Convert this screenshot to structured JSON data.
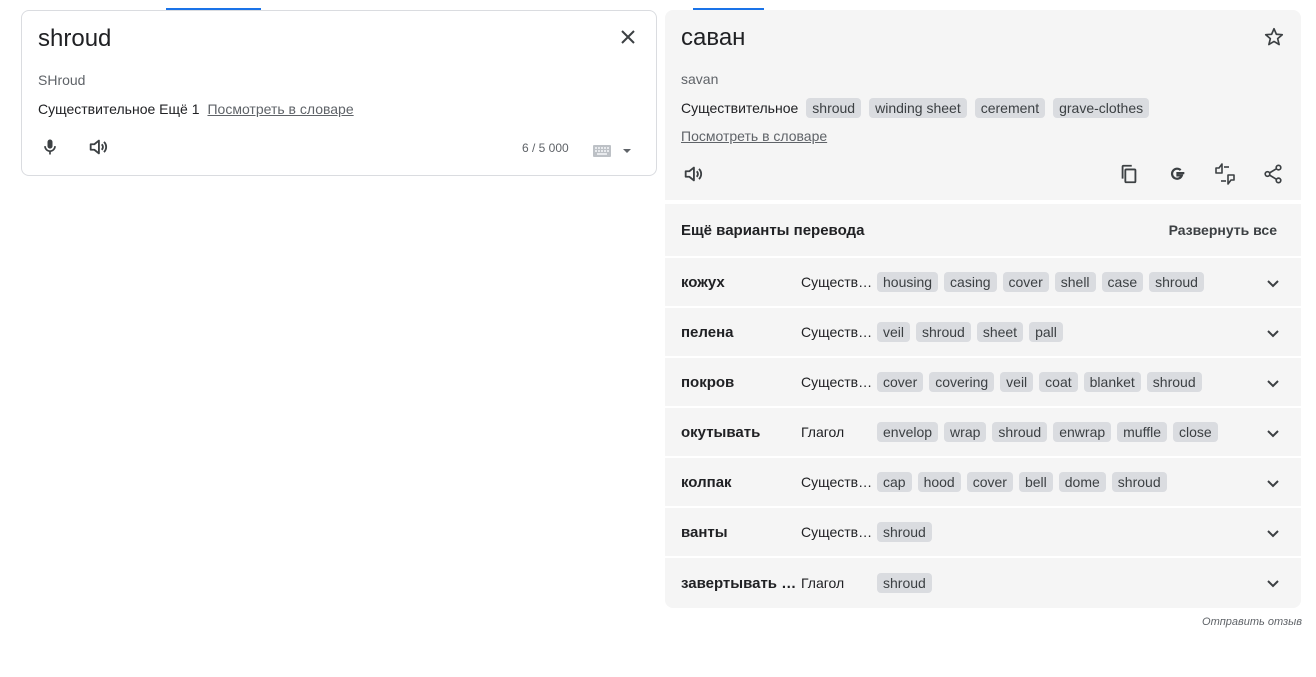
{
  "source": {
    "text": "shroud",
    "transliteration": "SHroud",
    "pos_label": "Существительное Ещё 1",
    "dictionary_link": "Посмотреть в словаре",
    "char_count": "6 / 5 000"
  },
  "target": {
    "text": "саван",
    "transliteration": "savan",
    "pos_label": "Существительное",
    "chips": [
      "shroud",
      "winding sheet",
      "cerement",
      "grave-clothes"
    ],
    "dictionary_link": "Посмотреть в словаре"
  },
  "alternatives": {
    "title": "Ещё варианты перевода",
    "expand_all": "Развернуть все",
    "rows": [
      {
        "word": "кожух",
        "pos": "Существительное",
        "chips": [
          "housing",
          "casing",
          "cover",
          "shell",
          "case",
          "shroud"
        ]
      },
      {
        "word": "пелена",
        "pos": "Существительное",
        "chips": [
          "veil",
          "shroud",
          "sheet",
          "pall"
        ]
      },
      {
        "word": "покров",
        "pos": "Существительное",
        "chips": [
          "cover",
          "covering",
          "veil",
          "coat",
          "blanket",
          "shroud"
        ]
      },
      {
        "word": "окутывать",
        "pos": "Глагол",
        "chips": [
          "envelop",
          "wrap",
          "shroud",
          "enwrap",
          "muffle",
          "close"
        ]
      },
      {
        "word": "колпак",
        "pos": "Существительное",
        "chips": [
          "cap",
          "hood",
          "cover",
          "bell",
          "dome",
          "shroud"
        ]
      },
      {
        "word": "ванты",
        "pos": "Существительное",
        "chips": [
          "shroud"
        ]
      },
      {
        "word": "завертывать в саван",
        "pos": "Глагол",
        "chips": [
          "shroud"
        ]
      }
    ]
  },
  "feedback_label": "Отправить отзыв",
  "colors": {
    "accent": "#1a73e8",
    "panel_bg": "#f5f5f5",
    "chip_bg": "#dadce0"
  },
  "icons": [
    "close-icon",
    "mic-icon",
    "speaker-icon",
    "keyboard-icon",
    "dropdown-arrow-icon",
    "star-icon",
    "copy-icon",
    "google-icon",
    "rate-icon",
    "share-icon",
    "chevron-down-icon"
  ]
}
